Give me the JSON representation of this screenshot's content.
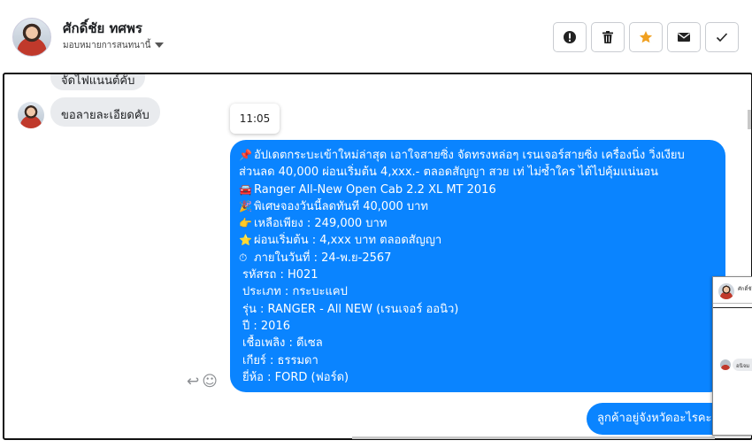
{
  "header": {
    "name": "ศักดิ์ชัย ทศพร",
    "subtitle": "มอบหมายการสนทนานี้",
    "icons": [
      "alert-icon",
      "trash-icon",
      "star-icon",
      "envelope-icon",
      "check-icon"
    ],
    "star_color": "#f0a020"
  },
  "messages": {
    "in_1": "จัดไฟแนนต์คับ",
    "in_2": "ขอลายละเอียดคับ",
    "time": "11:05",
    "out_lines": [
      {
        "emoji": "📌",
        "text": "อัปเดตกระบะเข้าใหม่ล่าสุด เอาใจสายซิ่ง จัดทรงหล่อๆ เรนเจอร์สายซิ่ง เครื่องนิ่ง วิ่งเงียบ"
      },
      {
        "emoji": "",
        "text": "ส่วนลด 40,000 ผ่อนเริ่มต้น 4,xxx.- ตลอดสัญญา สวย เท่ ไม่ซ้ำใคร ได้ไปคุ้มแน่นอน"
      },
      {
        "emoji": "🚘",
        "text": "Ranger All-New Open Cab 2.2 XL MT 2016"
      },
      {
        "emoji": "🎉",
        "text": "พิเศษจองวันนี้ลดทันที 40,000 บาท"
      },
      {
        "emoji": "👉",
        "text": "เหลือเพียง : 249,000 บาท"
      },
      {
        "emoji": "⭐",
        "text": "ผ่อนเริ่มต้น : 4,xxx บาท ตลอดสัญญา"
      },
      {
        "emoji": "⏱",
        "text": "ภายในวันที่ : 24-พ.ย-2567"
      },
      {
        "emoji": "",
        "text": "รหัสรถ : H021"
      },
      {
        "emoji": "",
        "text": "ประเภท : กระบะแคป"
      },
      {
        "emoji": "",
        "text": "รุ่น : RANGER - All NEW (เรนเจอร์ ออนิว)"
      },
      {
        "emoji": "",
        "text": "ปี : 2016"
      },
      {
        "emoji": "",
        "text": "เชื้อเพลิง : ดีเซล"
      },
      {
        "emoji": "",
        "text": "เกียร์ : ธรรมดา"
      },
      {
        "emoji": "",
        "text": "ยี่ห้อ : FORD (ฟอร์ด)"
      }
    ],
    "out_last": "ลูกค้าอยู่จังหวัดอะไรคะ"
  },
  "mini_popup": {
    "name": "ศักดิ์ชัย ทศพร",
    "snippet": "อนิจม"
  },
  "colors": {
    "accent_blue": "#0a84ff",
    "incoming_gray": "#e9ebee"
  }
}
